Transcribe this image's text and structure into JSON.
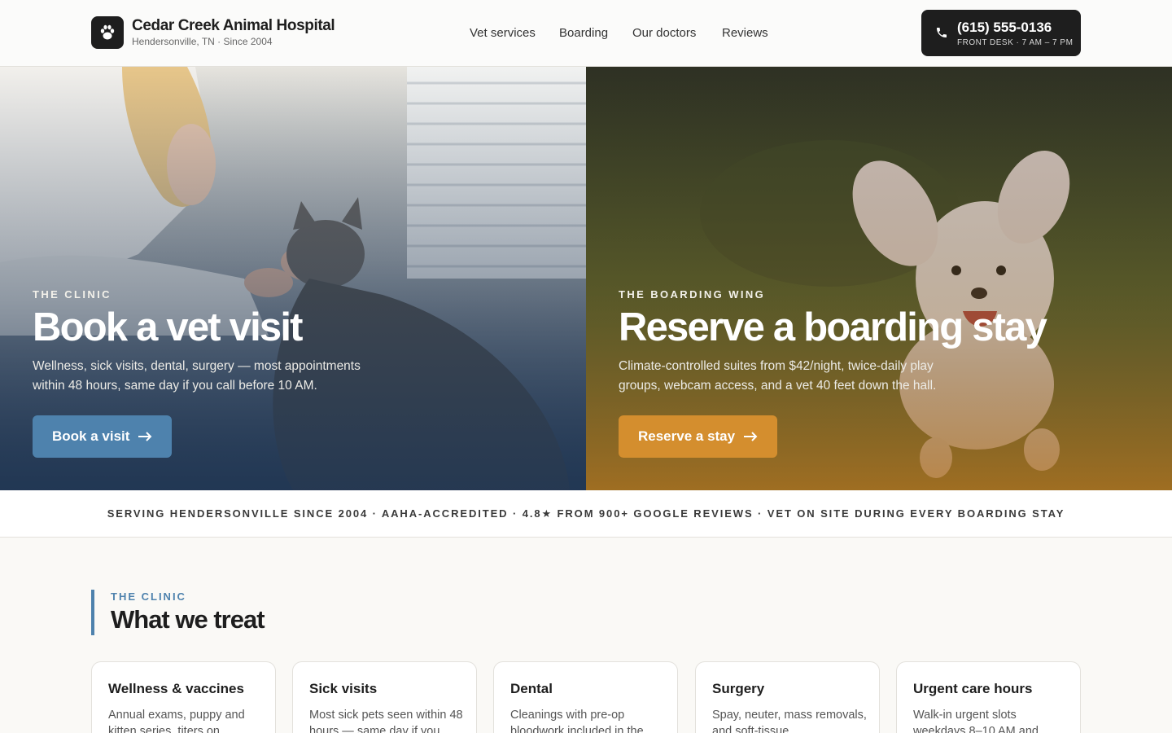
{
  "brand": {
    "name": "Cedar Creek Animal Hospital",
    "subtitle": "Hendersonville, TN · Since 2004",
    "logo_icon": "paw-icon"
  },
  "nav": {
    "items": [
      {
        "label": "Vet services"
      },
      {
        "label": "Boarding"
      },
      {
        "label": "Our doctors"
      },
      {
        "label": "Reviews"
      }
    ]
  },
  "phone": {
    "number": "(615) 555-0136",
    "hours": "FRONT DESK · 7 AM – 7 PM",
    "icon": "phone-icon"
  },
  "hero": {
    "clinic": {
      "kicker": "THE CLINIC",
      "title": "Book a vet visit",
      "description": "Wellness, sick visits, dental, surgery — most appointments within 48 hours, same day if you call before 10 AM.",
      "button_label": "Book a visit",
      "button_color": "#4e82ad"
    },
    "boarding": {
      "kicker": "THE BOARDING WING",
      "title": "Reserve a boarding stay",
      "description": "Climate-controlled suites from $42/night, twice-daily play groups, webcam access, and a vet 40 feet down the hall.",
      "button_label": "Reserve a stay",
      "button_color": "#d48e2e"
    }
  },
  "trust_strip": {
    "text": "SERVING HENDERSONVILLE SINCE 2004 · AAHA-ACCREDITED · 4.8★ FROM 900+ GOOGLE REVIEWS · VET ON SITE DURING EVERY BOARDING STAY"
  },
  "treat_section": {
    "kicker": "THE CLINIC",
    "title": "What we treat",
    "cards": [
      {
        "title": "Wellness & vaccines",
        "description": "Annual exams, puppy and kitten series, titers on"
      },
      {
        "title": "Sick visits",
        "description": "Most sick pets seen within 48 hours — same day if you"
      },
      {
        "title": "Dental",
        "description": "Cleanings with pre-op bloodwork included in the"
      },
      {
        "title": "Surgery",
        "description": "Spay, neuter, mass removals, and soft-tissue"
      },
      {
        "title": "Urgent care hours",
        "description": "Walk-in urgent slots weekdays 8–10 AM and"
      }
    ]
  },
  "colors": {
    "accent_blue": "#4e82ad",
    "accent_amber": "#d48e2e",
    "ink": "#1e1e1e"
  }
}
